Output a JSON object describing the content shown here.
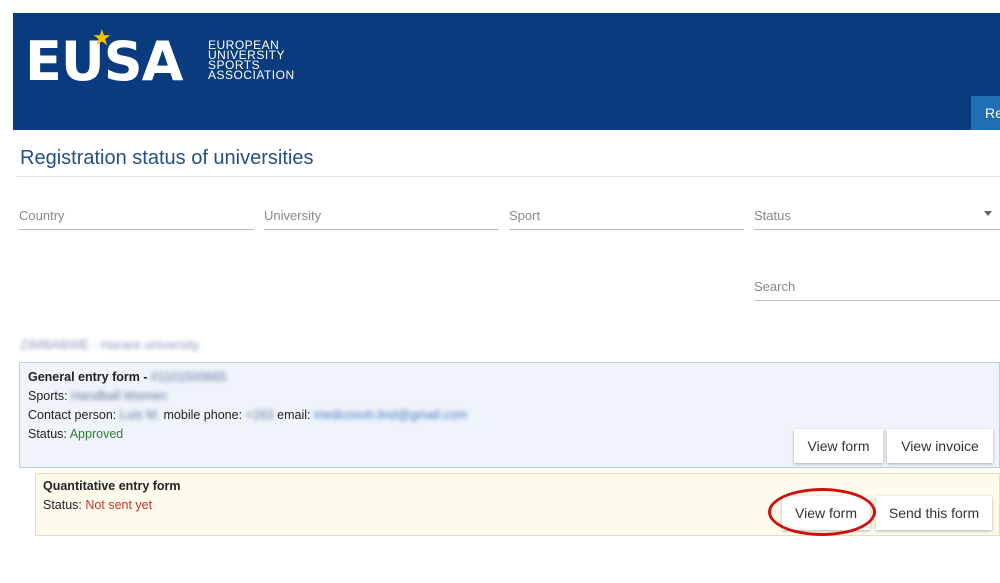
{
  "header": {
    "logo_text": "EUSA",
    "logo_subtitle": [
      "EUROPEAN",
      "UNIVERSITY",
      "SPORTS",
      "ASSOCIATION"
    ],
    "tab_label": "Registration"
  },
  "page": {
    "title": "Registration status of universities"
  },
  "filters": {
    "country_placeholder": "Country",
    "university_placeholder": "University",
    "sport_placeholder": "Sport",
    "status_placeholder": "Status",
    "search_placeholder": "Search"
  },
  "university": {
    "heading": "ZIMBABWE - Harare university"
  },
  "general_form": {
    "title": "General entry form -",
    "form_id": "#1101500665",
    "sports_label": "Sports:",
    "sports_value": "Handball Women",
    "contact_label": "Contact person:",
    "contact_value": "Luis M.",
    "phone_label": "mobile phone:",
    "phone_value": "+263",
    "email_label": "email:",
    "email_value": "medicosoh.lind@gmail.com",
    "status_label": "Status:",
    "status_value": "Approved",
    "view_form_label": "View form",
    "view_invoice_label": "View invoice"
  },
  "quantitative_form": {
    "title": "Quantitative entry form",
    "status_label": "Status:",
    "status_value": "Not sent yet",
    "view_form_label": "View form",
    "send_form_label": "Send this form"
  },
  "colors": {
    "header_bg": "#0b3b7f",
    "tab_bg": "#1e6eb3",
    "approved": "#2e7d32",
    "not_sent": "#d32f2f",
    "highlight_circle": "#d01010"
  }
}
